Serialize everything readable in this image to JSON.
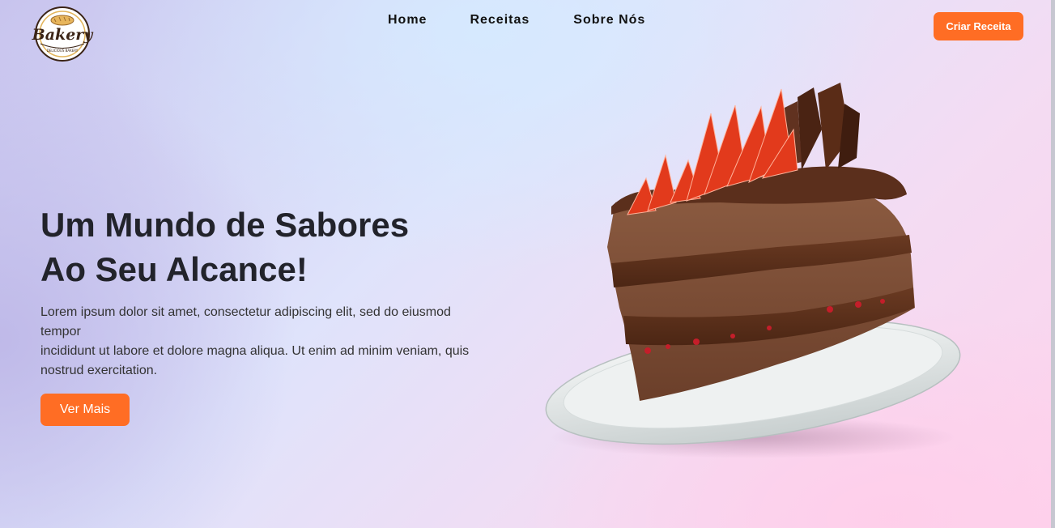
{
  "brand": {
    "name": "Bakery",
    "tagline": "DELICIOUS BAKERY"
  },
  "nav": {
    "items": [
      "Home",
      "Receitas",
      "Sobre Nós"
    ]
  },
  "header": {
    "cta_label": "Criar Receita"
  },
  "hero": {
    "title_line1": "Um Mundo de Sabores",
    "title_line2": "Ao Seu Alcance!",
    "text_line1": "Lorem ipsum dolor sit amet, consectetur adipiscing elit, sed do eiusmod",
    "text_line2": "tempor",
    "text_line3": "incididunt ut labore et dolore magna aliqua. Ut enim ad minim veniam, quis",
    "text_line4": "nostrud exercitation.",
    "button_label": "Ver Mais",
    "image": "chocolate-strawberry-cake-slice"
  },
  "colors": {
    "accent": "#ff6d24",
    "heading": "#22232b"
  }
}
